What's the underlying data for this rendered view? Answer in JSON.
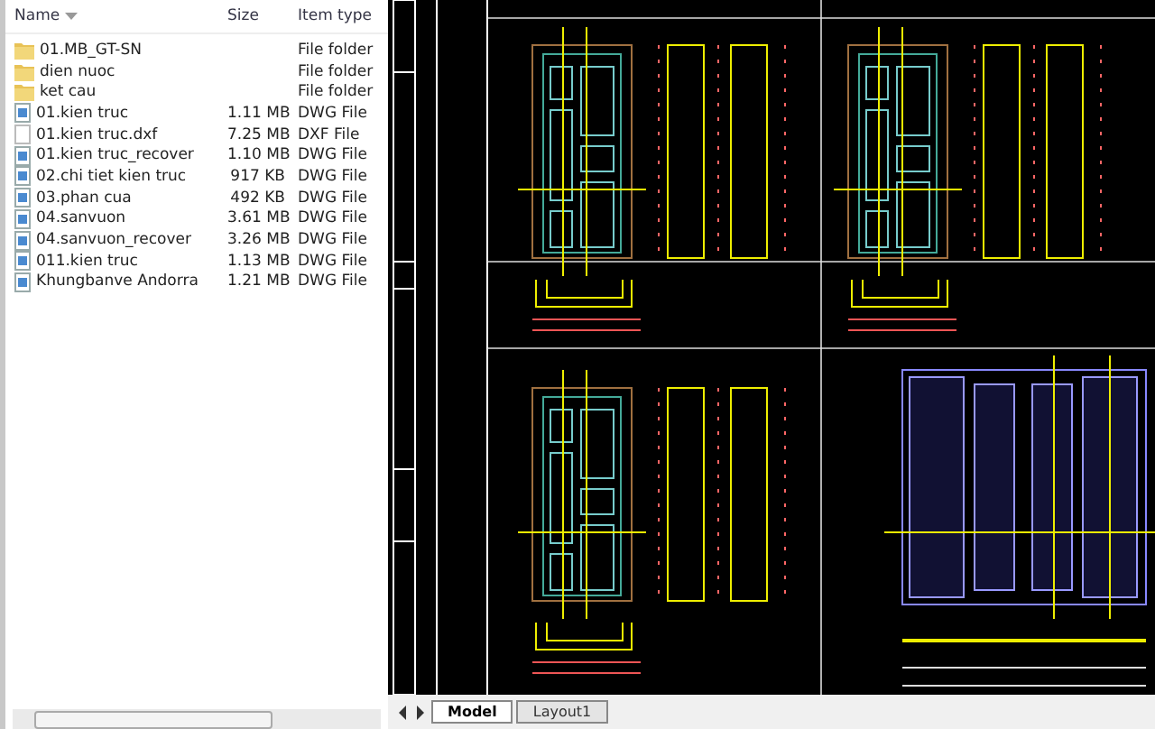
{
  "explorer": {
    "columns": [
      "Name",
      "Size",
      "Item type"
    ],
    "files": [
      {
        "name": "01.MB_GT-SN",
        "type": "File folder",
        "kind": "folder"
      },
      {
        "name": "dien nuoc",
        "type": "File folder",
        "kind": "folder"
      },
      {
        "name": "ket cau",
        "type": "File folder",
        "kind": "folder"
      },
      {
        "name": "01.kien truc",
        "size": "1.11 MB",
        "type": "DWG File",
        "kind": "dwg"
      },
      {
        "name": "01.kien truc.dxf",
        "size": "7.25 MB",
        "type": "DXF File",
        "kind": "dxf"
      },
      {
        "name": "01.kien truc_recover",
        "size": "1.10 MB",
        "type": "DWG File",
        "kind": "dwg"
      },
      {
        "name": "02.chi tiet kien truc",
        "size": "917 KB",
        "type": "DWG File",
        "kind": "dwg"
      },
      {
        "name": "03.phan cua",
        "size": "492 KB",
        "type": "DWG File",
        "kind": "dwg"
      },
      {
        "name": "04.sanvuon",
        "size": "3.61 MB",
        "type": "DWG File",
        "kind": "dwg"
      },
      {
        "name": "04.sanvuon_recover",
        "size": "3.26 MB",
        "type": "DWG File",
        "kind": "dwg"
      },
      {
        "name": "011.kien truc",
        "size": "1.13 MB",
        "type": "DWG File",
        "kind": "dwg"
      },
      {
        "name": "Khungbanve Andorra",
        "size": "1.21 MB",
        "type": "DWG File",
        "kind": "dwg"
      }
    ]
  },
  "cad": {
    "tabs": [
      {
        "label": "Model",
        "selected": true
      },
      {
        "label": "Layout1",
        "selected": false
      }
    ]
  }
}
